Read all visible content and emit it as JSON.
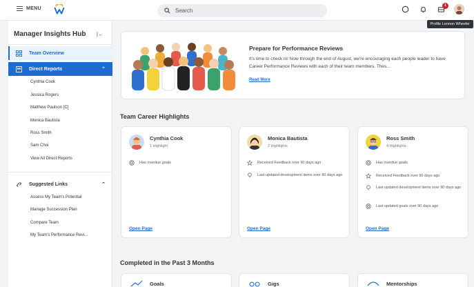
{
  "header": {
    "menu_label": "MENU",
    "search_placeholder": "Search",
    "notification_badge": "1",
    "profile_tooltip": "Profile Lennon Wheeler"
  },
  "sidebar": {
    "title": "Manager Insights Hub",
    "items": [
      {
        "label": "Team Overview"
      },
      {
        "label": "Direct Reports"
      }
    ],
    "direct_reports": [
      "Cynthia Cook",
      "Jessica Rogers",
      "Matthew Paulson [C]",
      "Monica Bautista",
      "Ross Smith",
      "Sam Choi",
      "View All Direct Reports"
    ],
    "suggested_label": "Suggested Links",
    "suggested_links": [
      "Assess My Team's Potential",
      "Manage Succession Plan",
      "Compare Team",
      "My Team's Performance Revi..."
    ]
  },
  "hero": {
    "title": "Prepare for Performance Reviews",
    "body": "It's time to check in! Now through the end of August, we're encouraging each people leader to have Career Performance Reviews with each of their team members. Thes...",
    "link": "Read More"
  },
  "highlights": {
    "title": "Team Career Highlights",
    "cards": [
      {
        "name": "Cynthia Cook",
        "count": "1 Highlight",
        "rows": [
          {
            "icon": "target-icon",
            "text": "Has overdue goals"
          }
        ],
        "link": "Open Page"
      },
      {
        "name": "Monica Bautista",
        "count": "2 Highlights",
        "rows": [
          {
            "icon": "star-icon",
            "text": "Received Feedback over 90 days ago"
          },
          {
            "icon": "lightbulb-icon",
            "text": "Last updated development items over 90 days ago"
          }
        ],
        "link": "Open Page"
      },
      {
        "name": "Ross Smith",
        "count": "4 Highlights",
        "rows": [
          {
            "icon": "target-icon",
            "text": "Has overdue goals"
          },
          {
            "icon": "star-icon",
            "text": "Received Feedback over 90 days ago"
          },
          {
            "icon": "lightbulb-icon",
            "text": "Last updated development items over 90 days ago"
          },
          {
            "icon": "target-icon",
            "text": "Last updated goals over 90 days ago"
          }
        ],
        "link": "Open Page"
      }
    ]
  },
  "completed": {
    "title": "Completed in the Past 3 Months",
    "cards": [
      {
        "label": "Goals"
      },
      {
        "label": "Gigs"
      },
      {
        "label": "Mentorships"
      }
    ]
  },
  "colors": {
    "accent": "#1e6bd1",
    "badge": "#d0202a"
  }
}
